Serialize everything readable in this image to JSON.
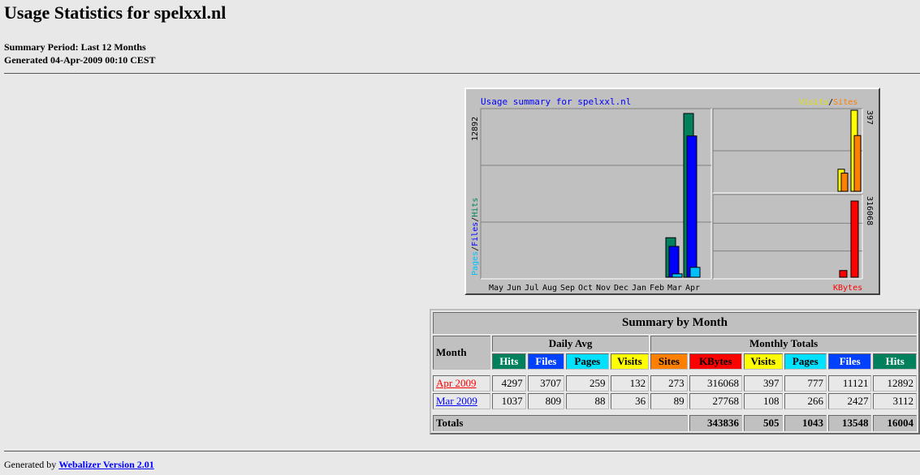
{
  "page": {
    "title": "Usage Statistics for spelxxl.nl",
    "summary_period": "Summary Period: Last 12 Months",
    "generated": "Generated 04-Apr-2009 00:10 CEST",
    "footer_prefix": "Generated by ",
    "footer_link": "Webalizer Version 2.01"
  },
  "chart_data": {
    "type": "bar",
    "title": "Usage summary for spelxxl.nl",
    "categories": [
      "May",
      "Jun",
      "Jul",
      "Aug",
      "Sep",
      "Oct",
      "Nov",
      "Dec",
      "Jan",
      "Feb",
      "Mar",
      "Apr"
    ],
    "left_panel": {
      "axis_label_parts": [
        "Pages",
        "/",
        "Files",
        "/",
        "Hits"
      ],
      "max_label": "12892",
      "max": 12892,
      "series": [
        {
          "name": "Hits",
          "color": "#00805c",
          "values": [
            0,
            0,
            0,
            0,
            0,
            0,
            0,
            0,
            0,
            0,
            3112,
            12892
          ]
        },
        {
          "name": "Files",
          "color": "#0000ff",
          "values": [
            0,
            0,
            0,
            0,
            0,
            0,
            0,
            0,
            0,
            0,
            2427,
            11121
          ]
        },
        {
          "name": "Pages",
          "color": "#00c0ff",
          "values": [
            0,
            0,
            0,
            0,
            0,
            0,
            0,
            0,
            0,
            0,
            266,
            777
          ]
        }
      ]
    },
    "top_right_panel": {
      "legend_parts": [
        "Visits",
        "/",
        "Sites"
      ],
      "max_label": "397",
      "max": 397,
      "series": [
        {
          "name": "Visits",
          "color": "#ffff00",
          "values": [
            108,
            397
          ]
        },
        {
          "name": "Sites",
          "color": "#ff8000",
          "values": [
            89,
            273
          ]
        }
      ]
    },
    "bottom_right_panel": {
      "legend": "KBytes",
      "max_label": "316068",
      "max": 316068,
      "series": [
        {
          "name": "KBytes",
          "color": "#ff0000",
          "values": [
            27768,
            316068
          ]
        }
      ]
    }
  },
  "table": {
    "title": "Summary by Month",
    "month_header": "Month",
    "group_daily": "Daily Avg",
    "group_monthly": "Monthly Totals",
    "col_labels": [
      "Hits",
      "Files",
      "Pages",
      "Visits",
      "Sites",
      "KBytes",
      "Visits",
      "Pages",
      "Files",
      "Hits"
    ],
    "rows": [
      {
        "month": "Apr 2009",
        "values": [
          "4297",
          "3707",
          "259",
          "132",
          "273",
          "316068",
          "397",
          "777",
          "11121",
          "12892"
        ]
      },
      {
        "month": "Mar 2009",
        "values": [
          "1037",
          "809",
          "88",
          "36",
          "89",
          "27768",
          "108",
          "266",
          "2427",
          "3112"
        ]
      }
    ],
    "totals": {
      "label": "Totals",
      "values": [
        "343836",
        "505",
        "1043",
        "13548",
        "16004"
      ]
    }
  },
  "colors": {
    "hits": "#00805c",
    "files": "#0040ff",
    "pages": "#00e0ff",
    "visits": "#ffff00",
    "sites": "#ff8000",
    "kbytes": "#ff0000"
  }
}
